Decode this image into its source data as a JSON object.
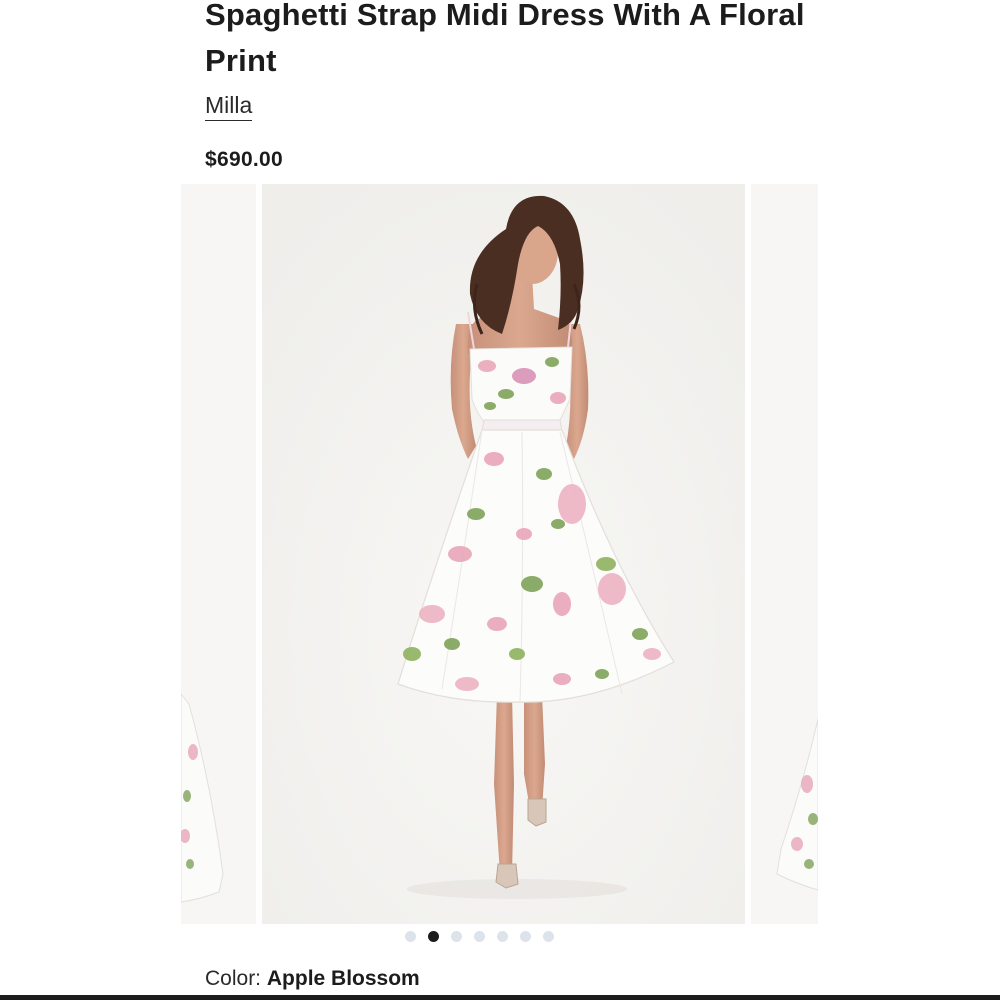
{
  "product": {
    "title": "Spaghetti Strap Midi Dress With A Floral Print",
    "brand": "Milla",
    "price": "$690.00"
  },
  "gallery": {
    "slide_count": 7,
    "active_index": 1,
    "main_image": "model-in-floral-dress"
  },
  "color": {
    "label": "Color:",
    "value": "Apple Blossom"
  },
  "colors": {
    "text": "#1c1c1c",
    "slide_bg": "#f4f3f1",
    "dot_inactive": "#dde3ea",
    "dot_active": "#1c1c1c",
    "floral_pink": "#e9a6b8",
    "floral_green": "#7fa35a"
  }
}
